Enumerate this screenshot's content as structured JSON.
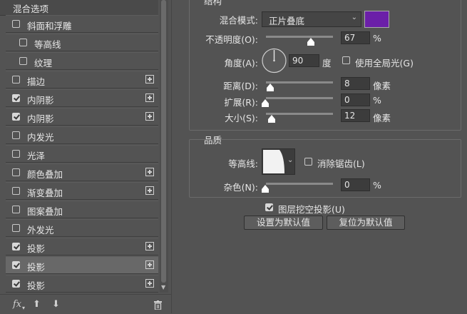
{
  "left": {
    "header": "混合选项",
    "items": [
      {
        "label": "斜面和浮雕",
        "checked": false,
        "plus": false,
        "indent": false,
        "selected": false
      },
      {
        "label": "等高线",
        "checked": false,
        "plus": false,
        "indent": true,
        "selected": false
      },
      {
        "label": "纹理",
        "checked": false,
        "plus": false,
        "indent": true,
        "selected": false
      },
      {
        "label": "描边",
        "checked": false,
        "plus": true,
        "indent": false,
        "selected": false
      },
      {
        "label": "内阴影",
        "checked": true,
        "plus": true,
        "indent": false,
        "selected": false
      },
      {
        "label": "内阴影",
        "checked": true,
        "plus": true,
        "indent": false,
        "selected": false
      },
      {
        "label": "内发光",
        "checked": false,
        "plus": false,
        "indent": false,
        "selected": false
      },
      {
        "label": "光泽",
        "checked": false,
        "plus": false,
        "indent": false,
        "selected": false
      },
      {
        "label": "颜色叠加",
        "checked": false,
        "plus": true,
        "indent": false,
        "selected": false
      },
      {
        "label": "渐变叠加",
        "checked": false,
        "plus": true,
        "indent": false,
        "selected": false
      },
      {
        "label": "图案叠加",
        "checked": false,
        "plus": false,
        "indent": false,
        "selected": false
      },
      {
        "label": "外发光",
        "checked": false,
        "plus": false,
        "indent": false,
        "selected": false
      },
      {
        "label": "投影",
        "checked": true,
        "plus": true,
        "indent": false,
        "selected": false
      },
      {
        "label": "投影",
        "checked": true,
        "plus": true,
        "indent": false,
        "selected": true
      },
      {
        "label": "投影",
        "checked": true,
        "plus": true,
        "indent": false,
        "selected": false
      }
    ],
    "footer": {
      "fx": "fx"
    }
  },
  "structure": {
    "title": "结构",
    "blend_label": "混合模式:",
    "blend_value": "正片叠底",
    "blend_color": "#6b1fa8",
    "opacity_label": "不透明度(O):",
    "opacity_value": "67",
    "opacity_unit": "%",
    "opacity_level": 0.67,
    "angle_label": "角度(A):",
    "angle_value": "90",
    "angle_unit": "度",
    "global_light_label": "使用全局光(G)",
    "distance_label": "距离(D):",
    "distance_value": "8",
    "distance_unit": "像素",
    "spread_label": "扩展(R):",
    "spread_value": "0",
    "spread_unit": "%",
    "size_label": "大小(S):",
    "size_value": "12",
    "size_unit": "像素"
  },
  "quality": {
    "title": "品质",
    "contour_label": "等高线:",
    "antialias_label": "消除锯齿(L)",
    "noise_label": "杂色(N):",
    "noise_value": "0",
    "noise_unit": "%"
  },
  "knockout_label": "图层挖空投影(U)",
  "set_default_label": "设置为默认值",
  "reset_default_label": "复位为默认值"
}
